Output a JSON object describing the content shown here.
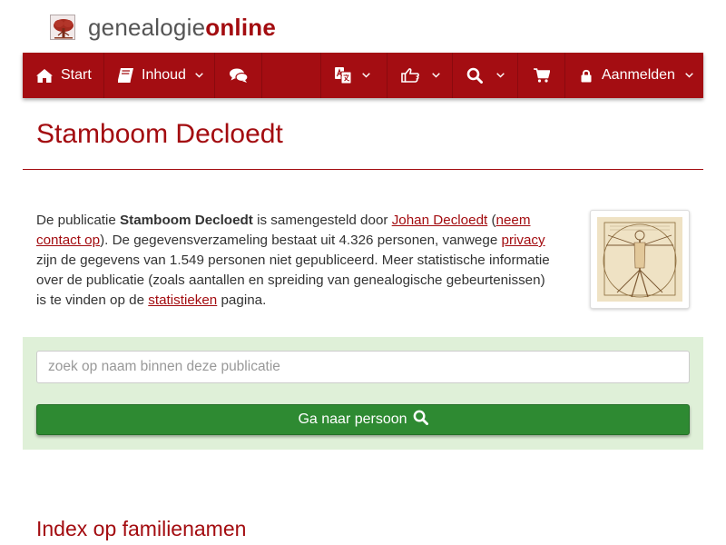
{
  "brand": {
    "name_light": "genealogie",
    "name_bold": "online",
    "logo_icon": "tree-logo-icon"
  },
  "nav": {
    "start": {
      "label": "Start",
      "icon": "home-icon"
    },
    "contents": {
      "label": "Inhoud",
      "icon": "book-icon"
    },
    "discussions": {
      "icon": "comments-icon"
    },
    "language": {
      "icon": "translate-icon"
    },
    "share": {
      "icon": "thumbs-up-icon"
    },
    "search": {
      "icon": "search-icon"
    },
    "shop": {
      "icon": "cart-icon"
    },
    "login": {
      "label": "Aanmelden",
      "icon": "lock-icon"
    }
  },
  "page": {
    "title": "Stamboom Decloedt",
    "section_heading": "Index op familienamen"
  },
  "description": {
    "t1": "De publicatie ",
    "publication": "Stamboom Decloedt",
    "t2": " is samengesteld door ",
    "author_link": "Johan Decloedt",
    "t3": " (",
    "contact_link": "neem contact op",
    "t4": "). De gegevensverzameling bestaat uit 4.326 personen, vanwege ",
    "privacy_link": "privacy",
    "t5": " zijn de gegevens van 1.549 personen niet gepubliceerd. Meer statistische informatie over de publicatie (zoals aantallen en spreiding van genealogische gebeurtenissen) is te vinden op de ",
    "stats_link": "statistieken",
    "t6": " pagina."
  },
  "search": {
    "placeholder": "zoek op naam binnen deze publicatie",
    "value": "",
    "button_label": "Ga naar persoon"
  },
  "colors": {
    "brand_red": "#a40d12",
    "panel_green": "#dff0d8",
    "button_green": "#2e8a32"
  }
}
